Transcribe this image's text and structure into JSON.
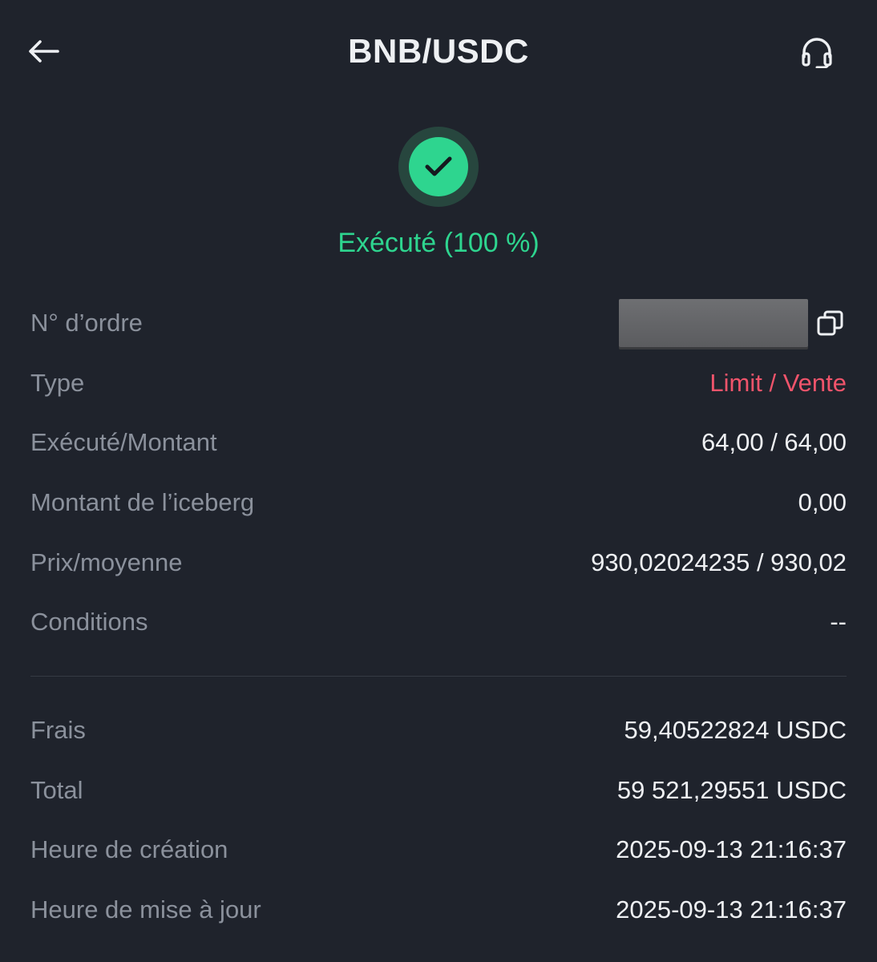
{
  "header": {
    "title": "BNB/USDC",
    "back_icon": "arrow-left-icon",
    "support_icon": "headset-icon"
  },
  "status": {
    "text": "Exécuté (100 %)",
    "icon": "check-circle-icon",
    "color": "#2ed58f"
  },
  "details": {
    "order_no_label": "N° d’ordre",
    "type_label": "Type",
    "type_value": "Limit / Vente",
    "executed_label": "Exécuté/Montant",
    "executed_value": "64,00 / 64,00",
    "iceberg_label": "Montant de l’iceberg",
    "iceberg_value": "0,00",
    "price_label": "Prix/moyenne",
    "price_value": "930,02024235 / 930,02",
    "conditions_label": "Conditions",
    "conditions_value": "--"
  },
  "summary": {
    "fees_label": "Frais",
    "fees_value": "59,40522824 USDC",
    "total_label": "Total",
    "total_value": "59 521,29551 USDC",
    "created_label": "Heure de création",
    "created_value": "2025-09-13 21:16:37",
    "updated_label": "Heure de mise à jour",
    "updated_value": "2025-09-13 21:16:37"
  },
  "colors": {
    "background": "#1f232c",
    "sell_red": "#f0546b",
    "success_green": "#2ed58f"
  }
}
